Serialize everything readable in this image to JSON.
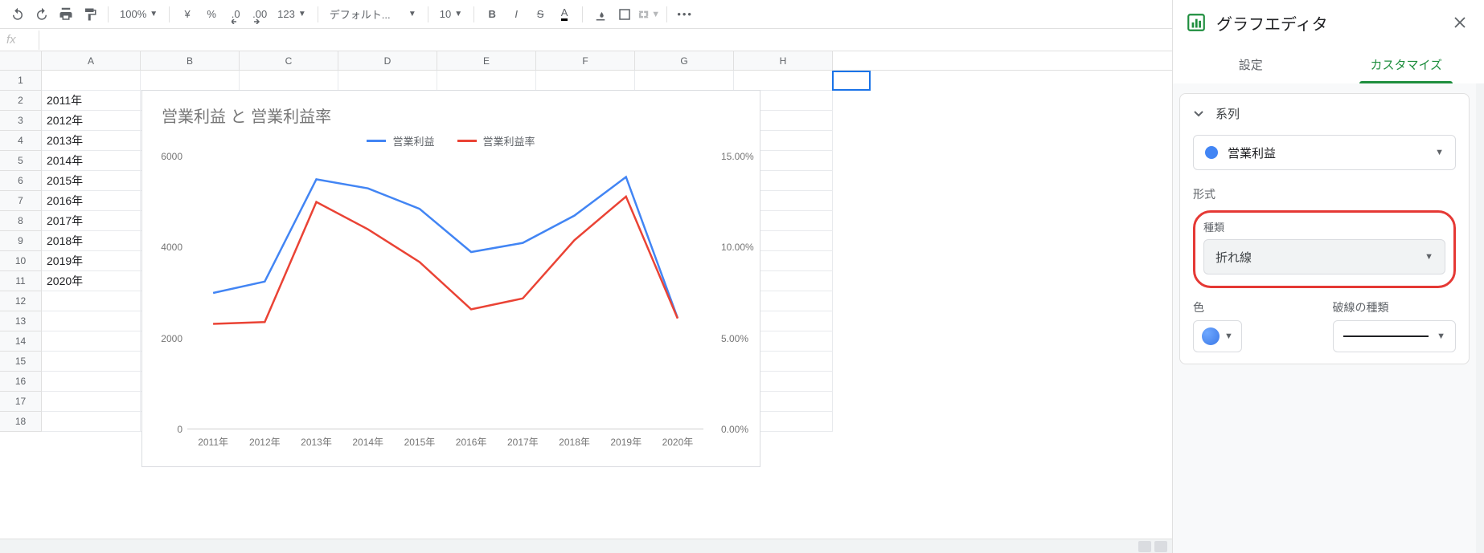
{
  "toolbar": {
    "zoom": "100%",
    "currency": "¥",
    "percent": "%",
    "dec_dec": ".0",
    "dec_inc": ".00",
    "numfmt": "123",
    "font": "デフォルト...",
    "font_size": "10"
  },
  "formula": {
    "fx": "fx",
    "value": ""
  },
  "columns": [
    "A",
    "B",
    "C",
    "D",
    "E",
    "F",
    "G",
    "H"
  ],
  "rows": [
    {
      "n": 1,
      "a": ""
    },
    {
      "n": 2,
      "a": "2011年"
    },
    {
      "n": 3,
      "a": "2012年"
    },
    {
      "n": 4,
      "a": "2013年"
    },
    {
      "n": 5,
      "a": "2014年"
    },
    {
      "n": 6,
      "a": "2015年"
    },
    {
      "n": 7,
      "a": "2016年"
    },
    {
      "n": 8,
      "a": "2017年"
    },
    {
      "n": 9,
      "a": "2018年"
    },
    {
      "n": 10,
      "a": "2019年"
    },
    {
      "n": 11,
      "a": "2020年"
    },
    {
      "n": 12,
      "a": ""
    },
    {
      "n": 13,
      "a": ""
    },
    {
      "n": 14,
      "a": ""
    },
    {
      "n": 15,
      "a": ""
    },
    {
      "n": 16,
      "a": ""
    },
    {
      "n": 17,
      "a": ""
    },
    {
      "n": 18,
      "a": ""
    }
  ],
  "chart_data": {
    "type": "line",
    "title": "営業利益 と 営業利益率",
    "categories": [
      "2011年",
      "2012年",
      "2013年",
      "2014年",
      "2015年",
      "2016年",
      "2017年",
      "2018年",
      "2019年",
      "2020年"
    ],
    "y_left": {
      "label": "",
      "ticks": [
        0,
        2000,
        4000,
        6000
      ],
      "lim": [
        0,
        6000
      ]
    },
    "y_right": {
      "label": "",
      "ticks": [
        "0.00%",
        "5.00%",
        "10.00%",
        "15.00%"
      ],
      "lim": [
        0,
        15
      ]
    },
    "series": [
      {
        "name": "営業利益",
        "axis": "left",
        "color": "#4285f4",
        "values": [
          3000,
          3250,
          5500,
          5300,
          4850,
          3900,
          4100,
          4700,
          5550,
          2450
        ]
      },
      {
        "name": "営業利益率",
        "axis": "right",
        "color": "#ea4335",
        "values": [
          5.8,
          5.9,
          12.5,
          11.0,
          9.2,
          6.6,
          7.2,
          10.4,
          12.8,
          6.1
        ]
      }
    ]
  },
  "sidebar": {
    "title": "グラフエディタ",
    "tabs": {
      "setup": "設定",
      "customize": "カスタマイズ"
    },
    "section_series": "系列",
    "series_selected": "営業利益",
    "label_format": "形式",
    "label_type": "種類",
    "type_value": "折れ線",
    "label_color": "色",
    "label_dash": "破線の種類"
  }
}
